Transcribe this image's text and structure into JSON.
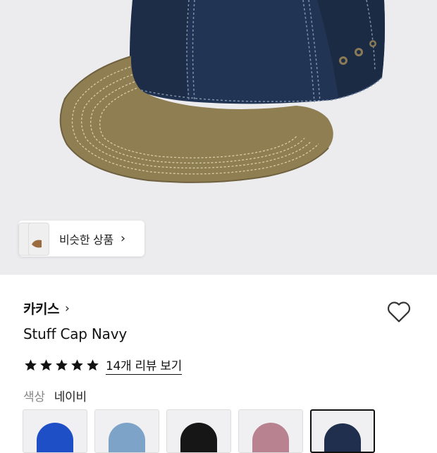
{
  "hero": {
    "similar_button_label": "비슷한 상품",
    "similar_chevron": "›"
  },
  "product": {
    "brand": "카키스",
    "brand_chevron": "›",
    "title": "Stuff Cap Navy",
    "rating_stars": 5,
    "reviews_label": "14개 리뷰 보기",
    "color_label": "색상",
    "color_value": "네이비",
    "colors": {
      "navy": "#1f2f4d",
      "khaki": "#8e7e52"
    },
    "swatches": [
      {
        "name": "blue",
        "color": "#1e4fc7",
        "selected": false
      },
      {
        "name": "light-blue",
        "color": "#7ea3c9",
        "selected": false
      },
      {
        "name": "black",
        "color": "#161616",
        "selected": false
      },
      {
        "name": "pink",
        "color": "#b98290",
        "selected": false
      },
      {
        "name": "navy",
        "color": "#1f2f4d",
        "selected": true
      }
    ]
  },
  "icons": {
    "heart": "heart-icon",
    "star": "star-icon",
    "chevron": "chevron-right-icon"
  }
}
